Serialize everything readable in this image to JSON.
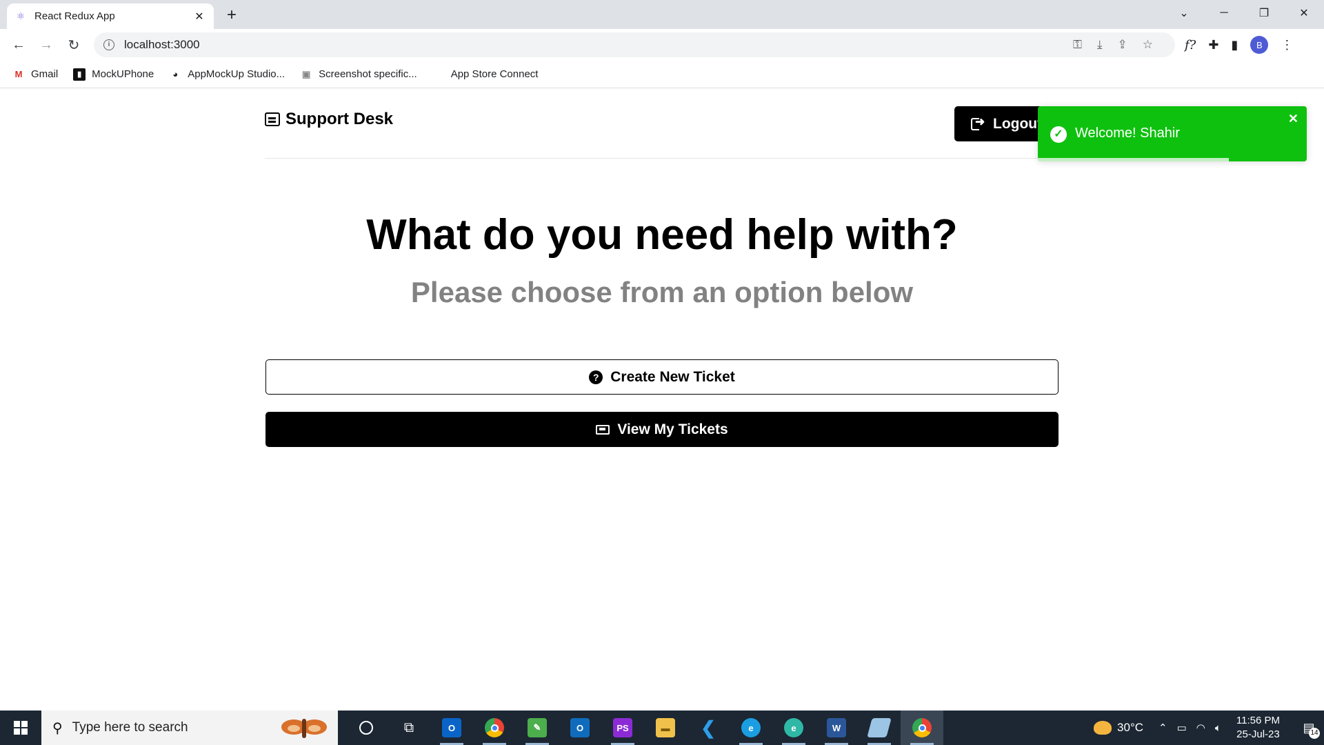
{
  "browser": {
    "tab_title": "React Redux App",
    "tab_close": "✕",
    "new_tab": "+",
    "url": "localhost:3000",
    "profile_initial": "B",
    "bookmarks": [
      {
        "label": "Gmail",
        "icon": "gmail-icon"
      },
      {
        "label": "MockUPhone",
        "icon": "mockuphone-icon"
      },
      {
        "label": "AppMockUp Studio...",
        "icon": "globe-icon"
      },
      {
        "label": "Screenshot specific...",
        "icon": "screenshot-icon"
      },
      {
        "label": "App Store Connect",
        "icon": "apple-icon"
      }
    ]
  },
  "app": {
    "logo_text": "Support Desk",
    "logout_label": "Logout",
    "heading": "What do you need help with?",
    "subheading": "Please choose from an option below",
    "create_ticket_label": "Create New Ticket",
    "view_tickets_label": "View My Tickets"
  },
  "toast": {
    "message": "Welcome! Shahir",
    "close": "✕",
    "progress_fraction": 0.71,
    "color": "#0fc10f"
  },
  "taskbar": {
    "search_placeholder": "Type here to search",
    "weather_temp": "30°C",
    "time": "11:56 PM",
    "date": "25-Jul-23",
    "notification_count": "14"
  },
  "colors": {
    "primary": "#000000",
    "subheading": "#828282",
    "toast_bg": "#0fc10f"
  }
}
